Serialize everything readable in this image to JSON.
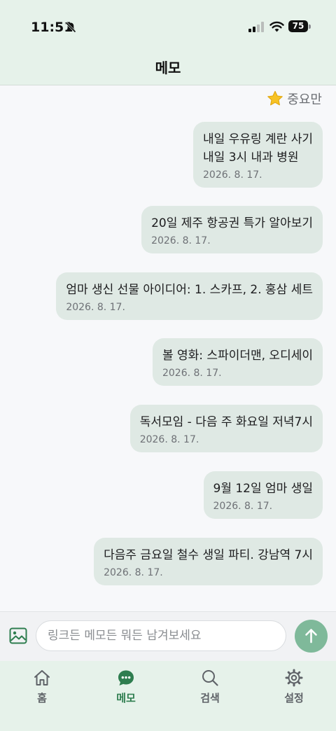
{
  "status_bar": {
    "time": "11:51",
    "battery": "75"
  },
  "header": {
    "title": "메모"
  },
  "filter": {
    "label": "중요만",
    "icon": "star-icon"
  },
  "memos": [
    {
      "text": "내일 우유링 계란 사기\n내일 3시 내과 병원",
      "date": "2026. 8. 17."
    },
    {
      "text": "20일 제주 항공권 특가 알아보기",
      "date": "2026. 8. 17."
    },
    {
      "text": "엄마 생신 선물 아이디어: 1. 스카프, 2. 홍삼 세트",
      "date": "2026. 8. 17."
    },
    {
      "text": "볼 영화: 스파이더맨, 오디세이",
      "date": "2026. 8. 17."
    },
    {
      "text": "독서모임 - 다음 주 화요일 저녁7시",
      "date": "2026. 8. 17."
    },
    {
      "text": "9월 12일 엄마 생일",
      "date": "2026. 8. 17."
    },
    {
      "text": "다음주 금요일 철수 생일 파티. 강남역 7시",
      "date": "2026. 8. 17."
    }
  ],
  "input": {
    "placeholder": "링크든 메모든 뭐든 남겨보세요",
    "value": ""
  },
  "tabs": [
    {
      "label": "홈",
      "icon": "home-icon"
    },
    {
      "label": "메모",
      "icon": "chat-icon",
      "active": true
    },
    {
      "label": "검색",
      "icon": "search-icon"
    },
    {
      "label": "설정",
      "icon": "gear-icon"
    }
  ],
  "colors": {
    "accent": "#2e7d4f",
    "bubble": "#dfe9e4",
    "header_bg": "#e6f2ea",
    "send_button": "#7fb99a"
  }
}
